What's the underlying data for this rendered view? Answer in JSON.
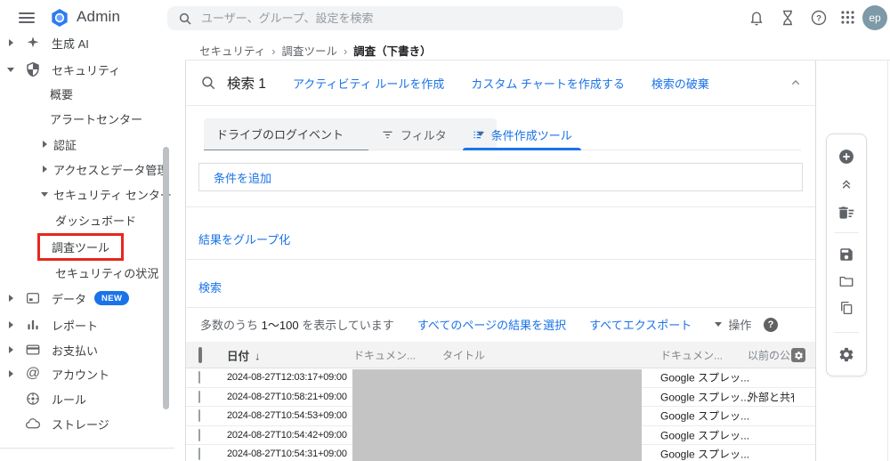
{
  "topbar": {
    "app_title": "Admin",
    "search_placeholder": "ユーザー、グループ、設定を検索",
    "avatar_initials": "ep"
  },
  "breadcrumb": {
    "level1": "セキュリティ",
    "level2": "調査ツール",
    "current": "調査（下書き）"
  },
  "sidebar": {
    "items": [
      {
        "label": "生成 AI"
      },
      {
        "label": "セキュリティ"
      },
      {
        "label": "概要"
      },
      {
        "label": "アラートセンター"
      },
      {
        "label": "認証"
      },
      {
        "label": "アクセスとデータ管理"
      },
      {
        "label": "セキュリティ センター"
      },
      {
        "label": "ダッシュボード"
      },
      {
        "label": "調査ツール"
      },
      {
        "label": "セキュリティの状況"
      },
      {
        "label": "データ",
        "badge": "NEW"
      },
      {
        "label": "レポート"
      },
      {
        "label": "お支払い"
      },
      {
        "label": "アカウント"
      },
      {
        "label": "ルール"
      },
      {
        "label": "ストレージ"
      }
    ]
  },
  "search_panel": {
    "title": "検索 1",
    "action_create_rule": "アクティビティ ルールを作成",
    "action_create_chart": "カスタム チャートを作成する",
    "action_discard": "検索の破棄",
    "data_source": "ドライブのログイベント",
    "tab_filter": "フィルタ",
    "tab_builder": "条件作成ツール",
    "add_condition": "条件を追加",
    "group_results": "結果をグループ化",
    "search_action": "検索"
  },
  "results": {
    "summary_prefix": "多数のうち",
    "summary_range": "1～100",
    "summary_suffix": "を表示しています",
    "select_all_pages": "すべてのページの結果を選択",
    "export_all": "すべてエクスポート",
    "actions_label": "操作",
    "columns": {
      "date": "日付",
      "doc_id": "ドキュメン...",
      "title": "タイトル",
      "doc_type": "ドキュメン...",
      "prior_visibility": "以前の公開"
    },
    "rows": [
      {
        "date": "2024-08-27T12:03:17+09:00",
        "doc_type": "Google スプレッ...",
        "visibility": ""
      },
      {
        "date": "2024-08-27T10:58:21+09:00",
        "doc_type": "Google スプレッ...",
        "visibility": "外部と共有中"
      },
      {
        "date": "2024-08-27T10:54:53+09:00",
        "doc_type": "Google スプレッ...",
        "visibility": ""
      },
      {
        "date": "2024-08-27T10:54:42+09:00",
        "doc_type": "Google スプレッ...",
        "visibility": ""
      },
      {
        "date": "2024-08-27T10:54:31+09:00",
        "doc_type": "Google スプレッ...",
        "visibility": ""
      }
    ]
  },
  "colors": {
    "accent_blue": "#1a73e8",
    "highlight_red": "#e8271e",
    "redaction_gray": "#c4c4c4",
    "avatar_bg": "#7e99a7"
  }
}
